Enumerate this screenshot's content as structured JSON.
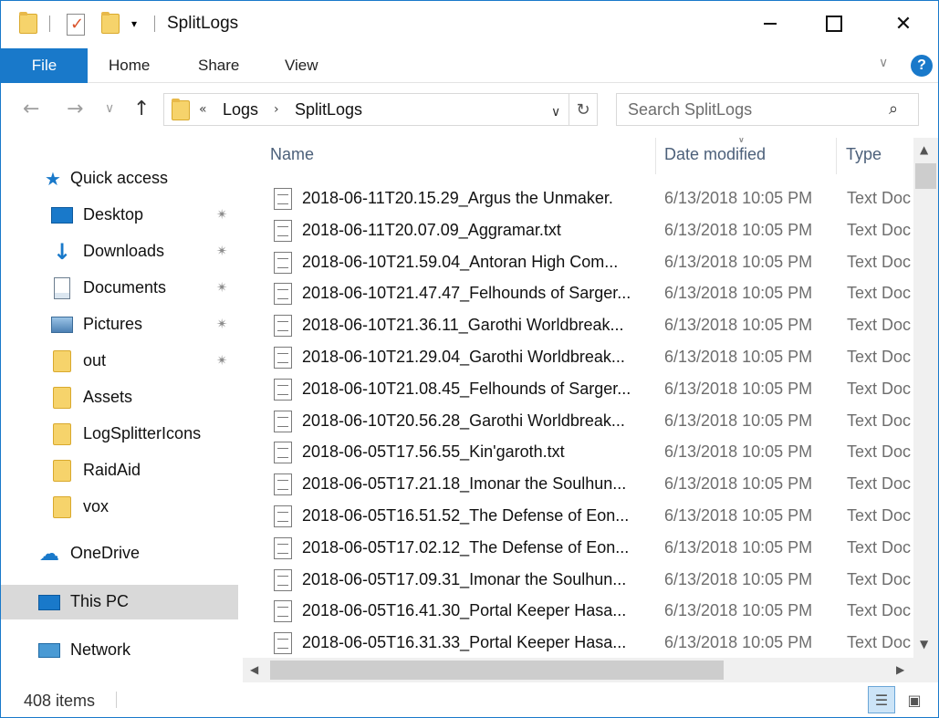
{
  "window": {
    "title": "SplitLogs",
    "qa_dropdown_glyph": "▾",
    "minimize_label": "",
    "close_glyph": "✕"
  },
  "ribbon": {
    "tabs": [
      "File",
      "Home",
      "Share",
      "View"
    ],
    "expand_glyph": "∨",
    "help_glyph": "?"
  },
  "navigation": {
    "back_glyph": "←",
    "forward_glyph": "→",
    "recent_glyph": "∨",
    "up_glyph": "↑",
    "breadcrumb": {
      "overflow": "«",
      "parts": [
        "Logs",
        "SplitLogs"
      ],
      "separator": "›"
    },
    "dropdown_glyph": "∨",
    "refresh_glyph": "↻",
    "search_placeholder": "Search SplitLogs",
    "search_glyph": "⌕"
  },
  "sidebar": {
    "quick_access": "Quick access",
    "pinned": [
      {
        "label": "Desktop",
        "icon": "desktop-icon"
      },
      {
        "label": "Downloads",
        "icon": "downloads-icon"
      },
      {
        "label": "Documents",
        "icon": "documents-icon"
      },
      {
        "label": "Pictures",
        "icon": "pictures-icon"
      },
      {
        "label": "out",
        "icon": "folder-icon"
      }
    ],
    "folders": [
      "Assets",
      "LogSplitterIcons",
      "RaidAid",
      "vox"
    ],
    "onedrive": "OneDrive",
    "this_pc": "This PC",
    "network": "Network",
    "pin_glyph": "✴"
  },
  "file_list": {
    "columns": {
      "name": "Name",
      "date": "Date modified",
      "type": "Type"
    },
    "sort_glyph": "∨",
    "rows": [
      {
        "name": "2018-06-11T20.15.29_Argus the Unmaker.",
        "date": "6/13/2018 10:05 PM",
        "type": "Text Doc"
      },
      {
        "name": "2018-06-11T20.07.09_Aggramar.txt",
        "date": "6/13/2018 10:05 PM",
        "type": "Text Doc"
      },
      {
        "name": "2018-06-10T21.59.04_Antoran High Com...",
        "date": "6/13/2018 10:05 PM",
        "type": "Text Doc"
      },
      {
        "name": "2018-06-10T21.47.47_Felhounds of Sarger...",
        "date": "6/13/2018 10:05 PM",
        "type": "Text Doc"
      },
      {
        "name": "2018-06-10T21.36.11_Garothi Worldbreak...",
        "date": "6/13/2018 10:05 PM",
        "type": "Text Doc"
      },
      {
        "name": "2018-06-10T21.29.04_Garothi Worldbreak...",
        "date": "6/13/2018 10:05 PM",
        "type": "Text Doc"
      },
      {
        "name": "2018-06-10T21.08.45_Felhounds of Sarger...",
        "date": "6/13/2018 10:05 PM",
        "type": "Text Doc"
      },
      {
        "name": "2018-06-10T20.56.28_Garothi Worldbreak...",
        "date": "6/13/2018 10:05 PM",
        "type": "Text Doc"
      },
      {
        "name": "2018-06-05T17.56.55_Kin'garoth.txt",
        "date": "6/13/2018 10:05 PM",
        "type": "Text Doc"
      },
      {
        "name": "2018-06-05T17.21.18_Imonar the Soulhun...",
        "date": "6/13/2018 10:05 PM",
        "type": "Text Doc"
      },
      {
        "name": "2018-06-05T16.51.52_The Defense of Eon...",
        "date": "6/13/2018 10:05 PM",
        "type": "Text Doc"
      },
      {
        "name": "2018-06-05T17.02.12_The Defense of Eon...",
        "date": "6/13/2018 10:05 PM",
        "type": "Text Doc"
      },
      {
        "name": "2018-06-05T17.09.31_Imonar the Soulhun...",
        "date": "6/13/2018 10:05 PM",
        "type": "Text Doc"
      },
      {
        "name": "2018-06-05T16.41.30_Portal Keeper Hasa...",
        "date": "6/13/2018 10:05 PM",
        "type": "Text Doc"
      },
      {
        "name": "2018-06-05T16.31.33_Portal Keeper Hasa...",
        "date": "6/13/2018 10:05 PM",
        "type": "Text Doc"
      }
    ]
  },
  "scrollbars": {
    "up": "▲",
    "down": "▼",
    "left": "◀",
    "right": "▶"
  },
  "status": {
    "item_count": "408 items",
    "details_view_glyph": "☰",
    "large_icons_glyph": "▣"
  },
  "colors": {
    "accent": "#1979ca",
    "column_header": "#4c607a",
    "muted_text": "#6d6d6d",
    "selected_nav": "#d9d9d9",
    "folder": "#f6d36b"
  }
}
